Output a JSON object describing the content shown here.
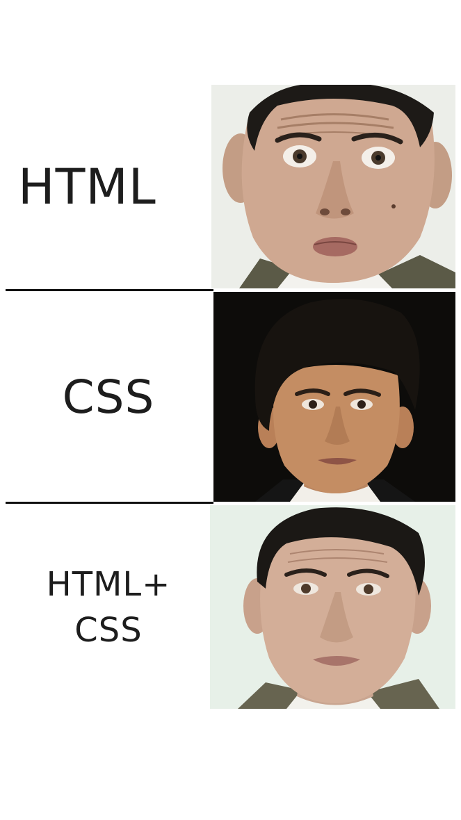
{
  "panels": [
    {
      "label": "HTML"
    },
    {
      "label": "CSS"
    },
    {
      "label_lines": [
        "HTML+",
        "CSS"
      ]
    }
  ]
}
